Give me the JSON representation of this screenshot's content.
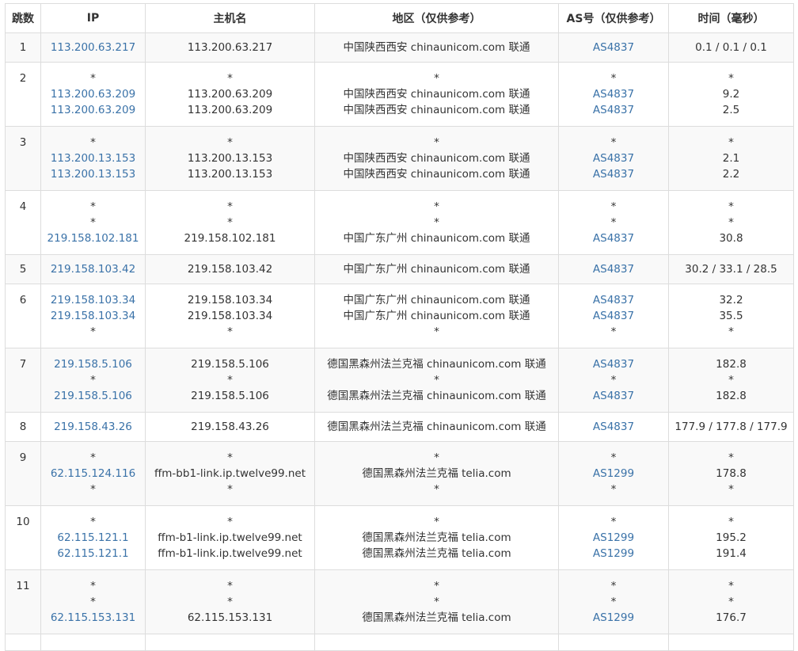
{
  "headers": {
    "hop": "跳数",
    "ip": "IP",
    "host": "主机名",
    "region": "地区（仅供参考）",
    "asn": "AS号（仅供参考）",
    "time": "时间（毫秒）"
  },
  "rows": [
    {
      "hop": "1",
      "ip": [
        "113.200.63.217"
      ],
      "host": [
        "113.200.63.217"
      ],
      "region": [
        "中国陕西西安 chinaunicom.com 联通"
      ],
      "asn": [
        "AS4837"
      ],
      "time": [
        "0.1 / 0.1 / 0.1"
      ]
    },
    {
      "hop": "2",
      "ip": [
        "*",
        "113.200.63.209",
        "113.200.63.209"
      ],
      "host": [
        "*",
        "113.200.63.209",
        "113.200.63.209"
      ],
      "region": [
        "*",
        "中国陕西西安 chinaunicom.com 联通",
        "中国陕西西安 chinaunicom.com 联通"
      ],
      "asn": [
        "*",
        "AS4837",
        "AS4837"
      ],
      "time": [
        "*",
        "9.2",
        "2.5"
      ]
    },
    {
      "hop": "3",
      "ip": [
        "*",
        "113.200.13.153",
        "113.200.13.153"
      ],
      "host": [
        "*",
        "113.200.13.153",
        "113.200.13.153"
      ],
      "region": [
        "*",
        "中国陕西西安 chinaunicom.com 联通",
        "中国陕西西安 chinaunicom.com 联通"
      ],
      "asn": [
        "*",
        "AS4837",
        "AS4837"
      ],
      "time": [
        "*",
        "2.1",
        "2.2"
      ]
    },
    {
      "hop": "4",
      "ip": [
        "*",
        "*",
        "219.158.102.181"
      ],
      "host": [
        "*",
        "*",
        "219.158.102.181"
      ],
      "region": [
        "*",
        "*",
        "中国广东广州 chinaunicom.com 联通"
      ],
      "asn": [
        "*",
        "*",
        "AS4837"
      ],
      "time": [
        "*",
        "*",
        "30.8"
      ]
    },
    {
      "hop": "5",
      "ip": [
        "219.158.103.42"
      ],
      "host": [
        "219.158.103.42"
      ],
      "region": [
        "中国广东广州 chinaunicom.com 联通"
      ],
      "asn": [
        "AS4837"
      ],
      "time": [
        "30.2 / 33.1 / 28.5"
      ]
    },
    {
      "hop": "6",
      "ip": [
        "219.158.103.34",
        "219.158.103.34",
        "*"
      ],
      "host": [
        "219.158.103.34",
        "219.158.103.34",
        "*"
      ],
      "region": [
        "中国广东广州 chinaunicom.com 联通",
        "中国广东广州 chinaunicom.com 联通",
        "*"
      ],
      "asn": [
        "AS4837",
        "AS4837",
        "*"
      ],
      "time": [
        "32.2",
        "35.5",
        "*"
      ]
    },
    {
      "hop": "7",
      "ip": [
        "219.158.5.106",
        "*",
        "219.158.5.106"
      ],
      "host": [
        "219.158.5.106",
        "*",
        "219.158.5.106"
      ],
      "region": [
        "德国黑森州法兰克福 chinaunicom.com 联通",
        "*",
        "德国黑森州法兰克福 chinaunicom.com 联通"
      ],
      "asn": [
        "AS4837",
        "*",
        "AS4837"
      ],
      "time": [
        "182.8",
        "*",
        "182.8"
      ]
    },
    {
      "hop": "8",
      "ip": [
        "219.158.43.26"
      ],
      "host": [
        "219.158.43.26"
      ],
      "region": [
        "德国黑森州法兰克福 chinaunicom.com 联通"
      ],
      "asn": [
        "AS4837"
      ],
      "time": [
        "177.9 / 177.8 / 177.9"
      ]
    },
    {
      "hop": "9",
      "ip": [
        "*",
        "62.115.124.116",
        "*"
      ],
      "host": [
        "*",
        "ffm-bb1-link.ip.twelve99.net",
        "*"
      ],
      "region": [
        "*",
        "德国黑森州法兰克福 telia.com",
        "*"
      ],
      "asn": [
        "*",
        "AS1299",
        "*"
      ],
      "time": [
        "*",
        "178.8",
        "*"
      ]
    },
    {
      "hop": "10",
      "ip": [
        "*",
        "62.115.121.1",
        "62.115.121.1"
      ],
      "host": [
        "*",
        "ffm-b1-link.ip.twelve99.net",
        "ffm-b1-link.ip.twelve99.net"
      ],
      "region": [
        "*",
        "德国黑森州法兰克福 telia.com",
        "德国黑森州法兰克福 telia.com"
      ],
      "asn": [
        "*",
        "AS1299",
        "AS1299"
      ],
      "time": [
        "*",
        "195.2",
        "191.4"
      ]
    },
    {
      "hop": "11",
      "ip": [
        "*",
        "*",
        "62.115.153.131"
      ],
      "host": [
        "*",
        "*",
        "62.115.153.131"
      ],
      "region": [
        "*",
        "*",
        "德国黑森州法兰克福 telia.com"
      ],
      "asn": [
        "*",
        "*",
        "AS1299"
      ],
      "time": [
        "*",
        "*",
        "176.7"
      ]
    }
  ],
  "colors": {
    "link": "#3a72a8",
    "text": "#333333",
    "border": "#dddddd",
    "stripe": "#f9f9f9"
  }
}
